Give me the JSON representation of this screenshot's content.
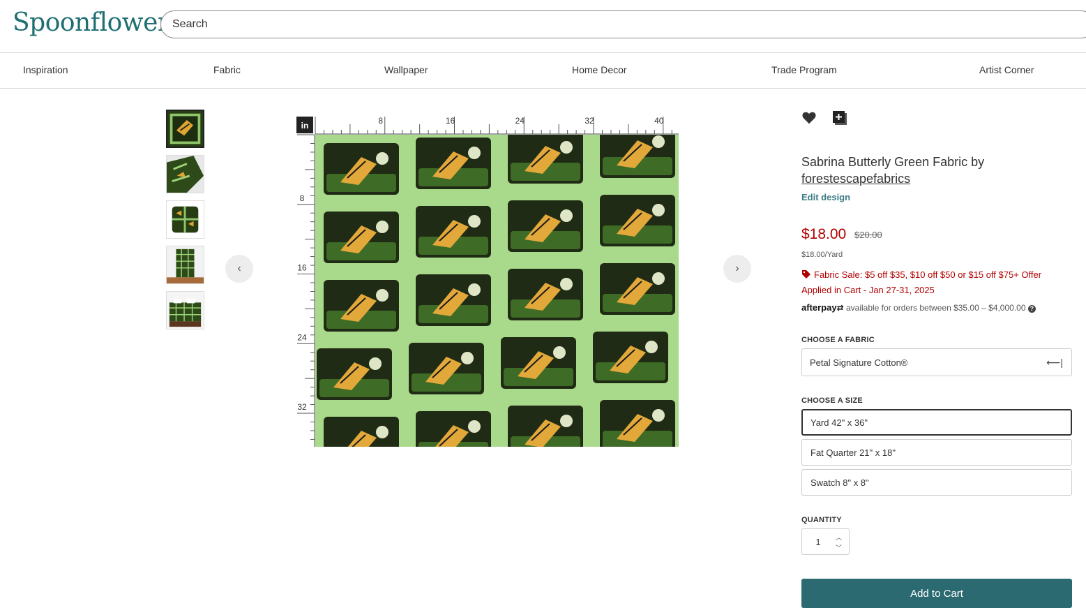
{
  "header": {
    "logo": "Spoonflower",
    "search_placeholder": "Search"
  },
  "nav": {
    "items": [
      "Inspiration",
      "Fabric",
      "Wallpaper",
      "Home Decor",
      "Trade Program",
      "Artist Corner"
    ]
  },
  "ruler": {
    "unit": "in",
    "top_labels": [
      "8",
      "16",
      "24",
      "32",
      "40"
    ],
    "left_labels": [
      "8",
      "16",
      "24",
      "32"
    ]
  },
  "gallery": {
    "prev_icon": "chevron-left-icon",
    "next_icon": "chevron-right-icon",
    "thumbnails": [
      "fabric-swatch",
      "fabric-drape",
      "pillow",
      "wall-hanging",
      "bedding"
    ]
  },
  "product": {
    "title_prefix": "Sabrina Butterly Green Fabric by",
    "designer": "forestescapefabrics",
    "edit_design": "Edit design",
    "price": "$18.00",
    "old_price": "$20.00",
    "unit_price": "$18.00/Yard",
    "sale_line1": "Fabric Sale: $5 off $35, $10 off $50 or $15 off $75+ Offer",
    "sale_line2": "Applied in Cart - Jan 27-31, 2025",
    "afterpay_logo": "afterpay",
    "afterpay_text": "available for orders between $35.00 – $4,000.00",
    "favorite_icon": "heart-icon",
    "collection_icon": "add-to-collection-icon"
  },
  "options": {
    "fabric_label": "CHOOSE A FABRIC",
    "fabric_value": "Petal Signature Cotton®",
    "size_label": "CHOOSE A SIZE",
    "sizes": [
      "Yard 42\" x 36\"",
      "Fat Quarter 21\" x 18\"",
      "Swatch 8\" x 8\""
    ],
    "selected_size": "Yard 42\" x 36\"",
    "quantity_label": "QUANTITY",
    "quantity": "1",
    "add_to_cart": "Add to Cart"
  },
  "colors": {
    "brand": "#1f6f73",
    "sale": "#b10000",
    "cart_button": "#2c6a72"
  }
}
